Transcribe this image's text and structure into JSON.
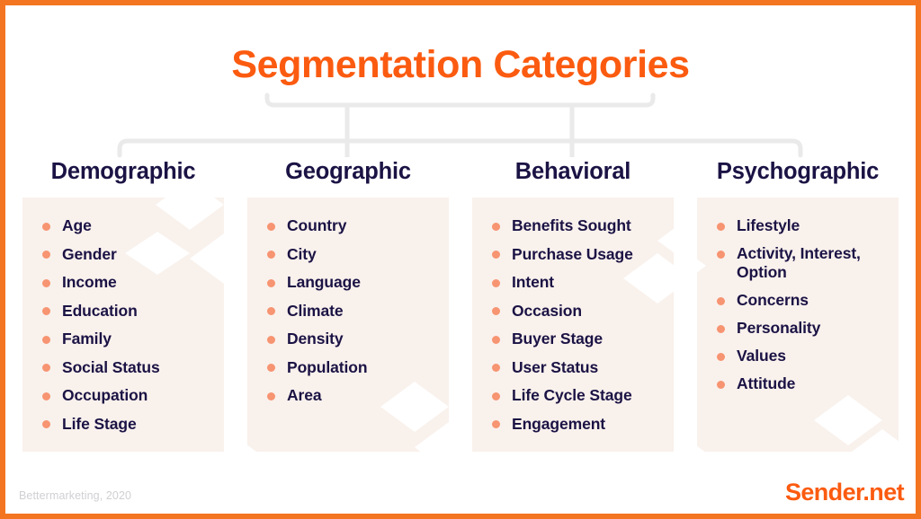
{
  "header": {
    "title": "Segmentation Categories"
  },
  "colors": {
    "accent_orange": "#FB5B10",
    "frame_orange": "#F47521",
    "heading_navy": "#1B1344",
    "bullet_coral": "#F79471",
    "card_cream": "#F9F1EC",
    "connector_gray": "#EAEAEA",
    "credit_gray": "#D0CFD2"
  },
  "columns": [
    {
      "id": "demographic",
      "heading": "Demographic",
      "items": [
        "Age",
        "Gender",
        "Income",
        "Education",
        "Family",
        "Social Status",
        "Occupation",
        "Life Stage"
      ]
    },
    {
      "id": "geographic",
      "heading": "Geographic",
      "items": [
        "Country",
        "City",
        "Language",
        "Climate",
        "Density",
        "Population",
        "Area"
      ]
    },
    {
      "id": "behavioral",
      "heading": "Behavioral",
      "items": [
        "Benefits Sought",
        "Purchase Usage",
        "Intent",
        "Occasion",
        "Buyer Stage",
        "User Status",
        "Life Cycle Stage",
        "Engagement"
      ]
    },
    {
      "id": "psychographic",
      "heading": "Psychographic",
      "items": [
        "Lifestyle",
        "Activity, Interest, Option",
        "Concerns",
        "Personality",
        "Values",
        "Attitude"
      ]
    }
  ],
  "footer": {
    "credit": "Bettermarketing, 2020",
    "logo": "Sender.net"
  }
}
